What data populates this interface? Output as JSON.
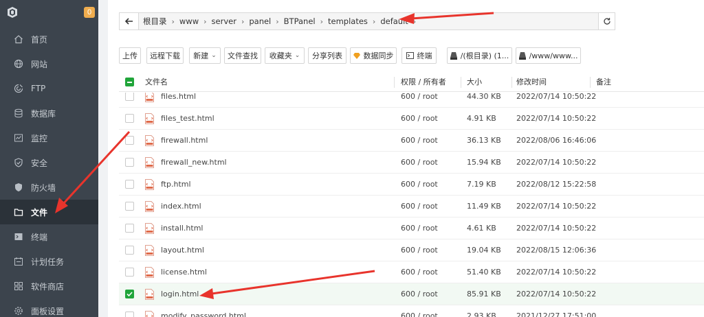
{
  "sidebar": {
    "badge": "0",
    "items": [
      {
        "label": "首页",
        "icon": "home-icon"
      },
      {
        "label": "网站",
        "icon": "globe-icon"
      },
      {
        "label": "FTP",
        "icon": "ftp-icon"
      },
      {
        "label": "数据库",
        "icon": "database-icon"
      },
      {
        "label": "监控",
        "icon": "monitor-icon"
      },
      {
        "label": "安全",
        "icon": "shield-icon"
      },
      {
        "label": "防火墙",
        "icon": "firewall-icon"
      },
      {
        "label": "文件",
        "icon": "folder-icon",
        "active": true
      },
      {
        "label": "终端",
        "icon": "terminal-icon"
      },
      {
        "label": "计划任务",
        "icon": "clock-icon"
      },
      {
        "label": "软件商店",
        "icon": "grid-icon"
      },
      {
        "label": "面板设置",
        "icon": "gear-icon"
      }
    ]
  },
  "breadcrumb": [
    "根目录",
    "www",
    "server",
    "panel",
    "BTPanel",
    "templates",
    "default"
  ],
  "toolbar": {
    "upload": "上传",
    "remote_download": "远程下载",
    "new": "新建",
    "file_search": "文件查找",
    "favorites": "收藏夹",
    "share_list": "分享列表",
    "data_sync": "数据同步",
    "terminal": "终端",
    "disk_root": "/(根目录) (1...",
    "disk_www": "/www/www..."
  },
  "columns": {
    "name": "文件名",
    "perm": "权限 / 所有者",
    "size": "大小",
    "mtime": "修改时间",
    "note": "备注"
  },
  "files": [
    {
      "name": "files.html",
      "perm": "600 / root",
      "size": "44.30 KB",
      "mtime": "2022/07/14 10:50:22",
      "checked": false
    },
    {
      "name": "files_test.html",
      "perm": "600 / root",
      "size": "4.91 KB",
      "mtime": "2022/07/14 10:50:22",
      "checked": false
    },
    {
      "name": "firewall.html",
      "perm": "600 / root",
      "size": "36.13 KB",
      "mtime": "2022/08/06 16:46:06",
      "checked": false
    },
    {
      "name": "firewall_new.html",
      "perm": "600 / root",
      "size": "15.94 KB",
      "mtime": "2022/07/14 10:50:22",
      "checked": false
    },
    {
      "name": "ftp.html",
      "perm": "600 / root",
      "size": "7.19 KB",
      "mtime": "2022/08/12 15:22:58",
      "checked": false
    },
    {
      "name": "index.html",
      "perm": "600 / root",
      "size": "11.49 KB",
      "mtime": "2022/07/14 10:50:22",
      "checked": false
    },
    {
      "name": "install.html",
      "perm": "600 / root",
      "size": "4.61 KB",
      "mtime": "2022/07/14 10:50:22",
      "checked": false
    },
    {
      "name": "layout.html",
      "perm": "600 / root",
      "size": "19.04 KB",
      "mtime": "2022/08/15 12:06:36",
      "checked": false
    },
    {
      "name": "license.html",
      "perm": "600 / root",
      "size": "51.40 KB",
      "mtime": "2022/07/14 10:50:22",
      "checked": false
    },
    {
      "name": "login.html",
      "perm": "600 / root",
      "size": "85.91 KB",
      "mtime": "2022/07/14 10:50:22",
      "checked": true
    },
    {
      "name": "modify_password.html",
      "perm": "600 / root",
      "size": "2.93 KB",
      "mtime": "2021/12/27 17:51:00",
      "checked": false
    }
  ],
  "colors": {
    "sidebar_bg": "#3c444d",
    "accent_green": "#20a53a",
    "badge_orange": "#f0ad4e",
    "arrow_red": "#e8342c"
  }
}
